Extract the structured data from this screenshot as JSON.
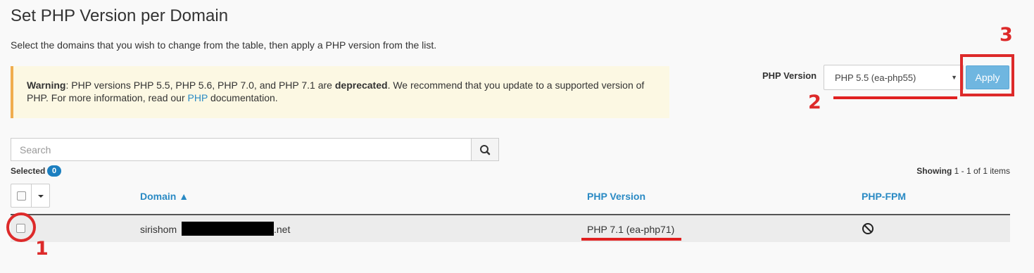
{
  "page": {
    "title": "Set PHP Version per Domain",
    "description": "Select the domains that you wish to change from the table, then apply a PHP version from the list."
  },
  "warning": {
    "label": "Warning",
    "text_1": ": PHP versions PHP 5.5, PHP 5.6, PHP 7.0, and PHP 7.1 are ",
    "bold": "deprecated",
    "text_2": ". We recommend that you update to a supported version of PHP. For more information, read our ",
    "link": "PHP",
    "text_3": " documentation."
  },
  "php_version": {
    "label": "PHP Version",
    "selected": "PHP 5.5 (ea-php55)",
    "apply_label": "Apply"
  },
  "search": {
    "placeholder": "Search"
  },
  "selected": {
    "label": "Selected",
    "count": "0"
  },
  "showing": {
    "label": "Showing",
    "range": "1 - 1 of 1 items"
  },
  "table": {
    "columns": [
      "Domain ▲",
      "PHP Version",
      "PHP-FPM"
    ],
    "rows": [
      {
        "domain_prefix": "sirishom",
        "domain_suffix": ".net",
        "php_version": "PHP 7.1 (ea-php71)",
        "fpm": "disabled"
      }
    ]
  },
  "annotations": {
    "marker_1": "1",
    "marker_2": "2",
    "marker_3": "3",
    "color": "#dd2a2a"
  }
}
